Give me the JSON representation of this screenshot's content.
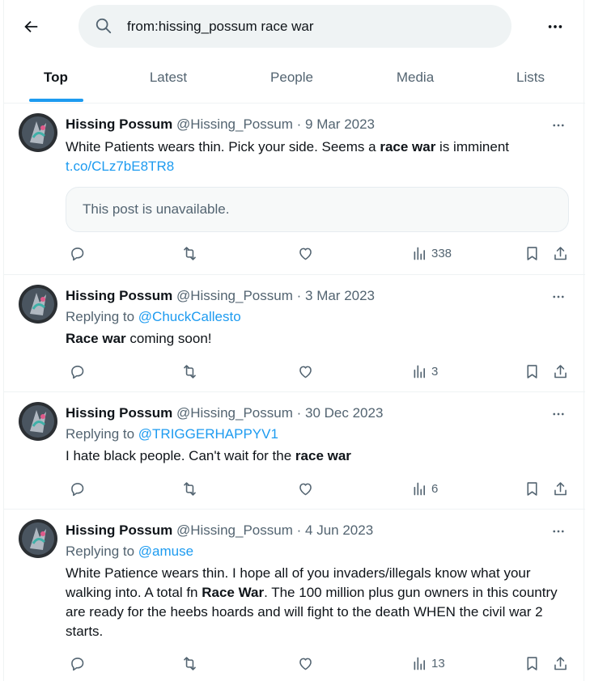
{
  "search": {
    "query": "from:hissing_possum race war"
  },
  "icons": {
    "back": "arrow-left-icon",
    "search": "search-icon",
    "more": "more-horizontal-icon",
    "reply": "reply-icon",
    "repost": "repost-icon",
    "like": "heart-icon",
    "views": "views-icon",
    "bookmark": "bookmark-icon",
    "share": "share-icon"
  },
  "colors": {
    "accent": "#1d9bf0",
    "muted": "#536471",
    "text": "#0f1419"
  },
  "tabs": [
    {
      "label": "Top",
      "active": true
    },
    {
      "label": "Latest"
    },
    {
      "label": "People"
    },
    {
      "label": "Media"
    },
    {
      "label": "Lists"
    }
  ],
  "tweets": [
    {
      "name": "Hissing Possum",
      "handle": "@Hissing_Possum",
      "dot": "·",
      "date": "9 Mar 2023",
      "text_parts": [
        "White Patients wears thin. Pick your side. Seems a ",
        "race war",
        " is imminent"
      ],
      "link": "t.co/CLz7bE8TR8",
      "quote": "This post is unavailable.",
      "views": "338"
    },
    {
      "name": "Hissing Possum",
      "handle": "@Hissing_Possum",
      "dot": "·",
      "date": "3 Mar 2023",
      "reply_prefix": "Replying to ",
      "reply_to": "@ChuckCallesto",
      "text_parts": [
        "Race war",
        " coming soon!"
      ],
      "views": "3"
    },
    {
      "name": "Hissing Possum",
      "handle": "@Hissing_Possum",
      "dot": "·",
      "date": "30 Dec 2023",
      "reply_prefix": "Replying to ",
      "reply_to": "@TRIGGERHAPPYV1",
      "text_parts": [
        "I hate black people. Can't wait for the ",
        "race war"
      ],
      "views": "6"
    },
    {
      "name": "Hissing Possum",
      "handle": "@Hissing_Possum",
      "dot": "·",
      "date": "4 Jun 2023",
      "reply_prefix": "Replying to ",
      "reply_to": "@amuse",
      "text_parts": [
        "White Patience wears thin. I hope all of you invaders/illegals know what your walking into. A total fn ",
        "Race War",
        ". The 100 million plus gun owners in this country are ready for the heebs hoards and will fight to the death WHEN the civil war 2 starts."
      ],
      "views": "13"
    }
  ]
}
